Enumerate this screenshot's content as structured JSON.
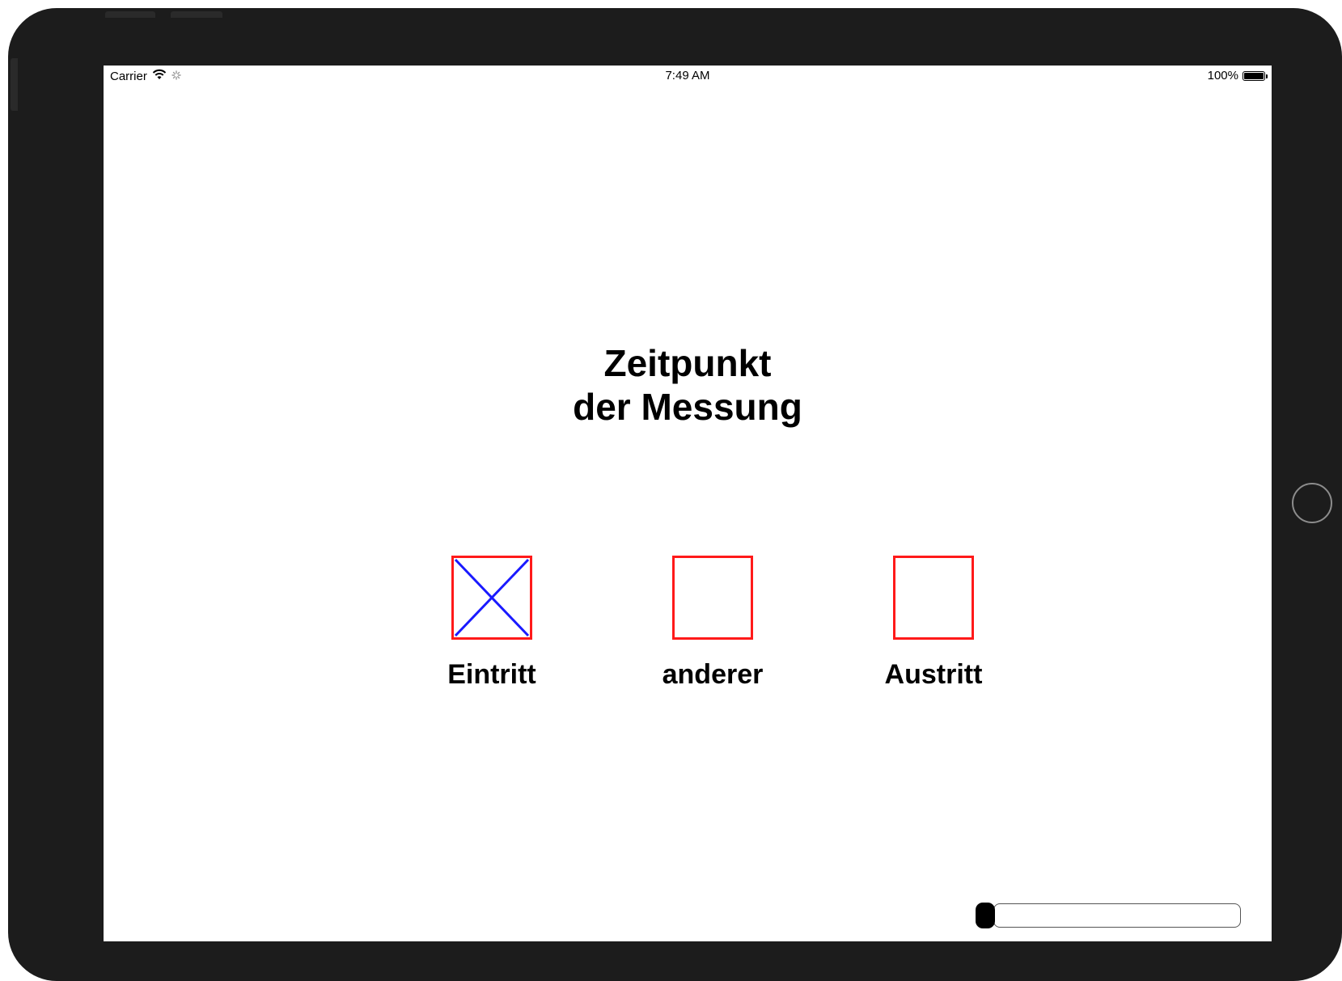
{
  "status_bar": {
    "carrier": "Carrier",
    "time": "7:49 AM",
    "battery": "100%",
    "battery_level": 1.0
  },
  "title": {
    "line1": "Zeitpunkt",
    "line2": "der Messung"
  },
  "options": [
    {
      "label": "Eintritt",
      "checked": true
    },
    {
      "label": "anderer",
      "checked": false
    },
    {
      "label": "Austritt",
      "checked": false
    }
  ],
  "colors": {
    "checkbox_border": "#ff1a1a",
    "checkmark": "#1a1aff",
    "device_frame": "#1c1c1c"
  },
  "icons": {
    "wifi": "wifi-icon",
    "activity": "activity-spinner-icon",
    "battery": "battery-icon",
    "check": "x-check-icon"
  },
  "progress": {
    "fraction": 0.0
  }
}
